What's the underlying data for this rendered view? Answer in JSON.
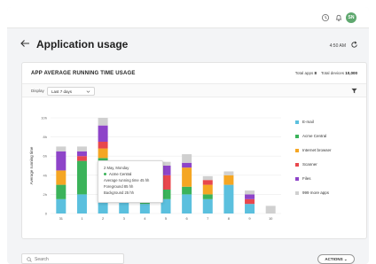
{
  "header": {
    "title": "Application usage",
    "time": "4:50 AM",
    "avatar_initials": "SN",
    "icons": [
      "history-icon",
      "bell-icon",
      "avatar"
    ]
  },
  "card": {
    "title": "APP AVERAGE RUNNING TIME USAGE",
    "total_apps_label": "Total apps",
    "total_apps_value": "8",
    "total_devices_label": "Total devices",
    "total_devices_value": "10,000"
  },
  "filter": {
    "display_label": "Display",
    "selected_range": "Last 7 days"
  },
  "chart_data": {
    "type": "bar",
    "stacked": true,
    "ylabel": "Average running time",
    "xlabel": "",
    "ylim": [
      0,
      10
    ],
    "yticks": [
      "0",
      "2h",
      "4h",
      "6h",
      "8h",
      "10h"
    ],
    "categories": [
      "31",
      "1",
      "2",
      "3",
      "4",
      "5",
      "6",
      "7",
      "8",
      "9",
      "10"
    ],
    "series": [
      {
        "name": "E-mail",
        "color": "#5bc0de",
        "values": [
          1.5,
          2.0,
          3.5,
          1.7,
          1.0,
          1.5,
          2.0,
          1.5,
          3.0,
          1.0,
          0
        ]
      },
      {
        "name": "Acme Central",
        "color": "#3bb35a",
        "values": [
          1.5,
          3.5,
          2.3,
          0,
          0.6,
          1.0,
          0.8,
          0.5,
          0,
          0,
          0
        ]
      },
      {
        "name": "Internet browser",
        "color": "#f5a623",
        "values": [
          1.5,
          0,
          1.0,
          0,
          0,
          0,
          2.0,
          1.0,
          1.0,
          0,
          0
        ]
      },
      {
        "name": "Scanner",
        "color": "#e8474d",
        "values": [
          0,
          0.5,
          0.7,
          0,
          0.6,
          1.5,
          0,
          0.5,
          0,
          0.5,
          0
        ]
      },
      {
        "name": "Files",
        "color": "#8e44c9",
        "values": [
          2.0,
          0.5,
          1.7,
          0,
          0.6,
          1.0,
          0.5,
          0,
          0,
          0.5,
          0
        ]
      },
      {
        "name": "999 more apps",
        "color": "#d0d0d0",
        "values": [
          0.5,
          0.5,
          0.8,
          0,
          0.3,
          0.4,
          0.9,
          0.4,
          0.4,
          0.4,
          0.8
        ]
      }
    ]
  },
  "tooltip": {
    "date": "2 May, Monday",
    "app": "Acme Central",
    "line1": "Average running time  45 hh",
    "line2": "Foreground  85 hh",
    "line3": "Background  25 hh"
  },
  "bottom": {
    "search_placeholder": "Search",
    "actions_label": "ACTIONS"
  }
}
